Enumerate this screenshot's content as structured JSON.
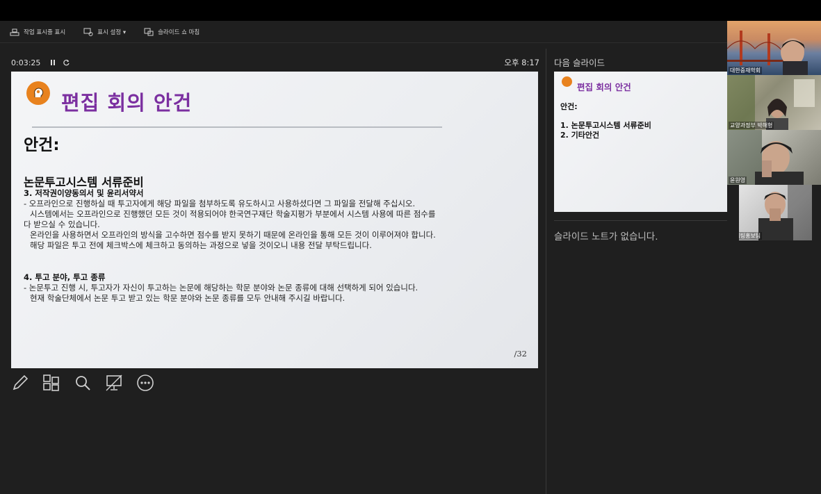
{
  "toolbar": {
    "taskbar_label": "작업 표시줄 표시",
    "display_settings_label": "표시 설정 ▾",
    "end_show_label": "슬라이드 쇼 마침"
  },
  "timer": {
    "elapsed": "0:03:25",
    "clock": "오후 8:17"
  },
  "slide": {
    "title": "편집 회의 안건",
    "agenda_heading": "안건:",
    "section1_heading": "논문투고시스템 서류준비",
    "section1_sub": "3. 저작권이양동의서 및 윤리서약서",
    "section1_lines": [
      "- 오프라인으로 진행하실 때 투고자에게 해당 파일을 첨부하도록 유도하시고 사용하셨다면 그 파일을 전달해 주십시오.",
      "시스템에서는 오프라인으로 진행했던 모든 것이 적용되어야 한국연구재단 학술지평가 부분에서 시스템 사용에 따른 점수를",
      "다 받으실 수 있습니다.",
      "온라인을 사용하면서 오프라인의 방식을 고수하면 점수를 받지 못하기 때문에 온라인을 통해 모든 것이 이루어져야 합니다.",
      "해당 파일은 투고 전에 체크박스에 체크하고 동의하는 과정으로 넣을 것이오니 내용 전달 부탁드립니다."
    ],
    "section2_sub": "4. 투고 분야, 투고 종류",
    "section2_lines": [
      "- 논문투고 진행 시, 투고자가 자신이 투고하는 논문에 해당하는 학문 분야와  논문 종류에 대해 선택하게 되어 있습니다.",
      "현재 학술단체에서 논문 투고 받고 있는 학문 분야와 논문 종류를 모두 안내해 주시길 바랍니다."
    ],
    "page_number": "/32"
  },
  "next": {
    "label": "다음 슬라이드",
    "title": "편집 회의 안건",
    "agenda": "안건:",
    "items": [
      "1.  논문투고시스템 서류준비",
      "2.  기타안건"
    ]
  },
  "notes": "슬라이드 노트가 없습니다.",
  "participants": [
    {
      "name": "대한중재학회"
    },
    {
      "name": "교양과정부 박해형"
    },
    {
      "name": "윤원영"
    },
    {
      "name": "마케팅홍보팀"
    }
  ],
  "icons": {
    "taskbar": "taskbar-icon",
    "display": "display-settings-icon",
    "end": "end-show-icon",
    "pause": "pause-icon",
    "restart": "restart-icon",
    "pen": "pen-icon",
    "all_slides": "all-slides-icon",
    "zoom": "zoom-icon",
    "black_screen": "black-screen-icon",
    "more": "more-options-icon"
  },
  "colors": {
    "accent_purple": "#7b2fa0",
    "logo_orange": "#e8821e",
    "panel": "#1f1f1f"
  }
}
